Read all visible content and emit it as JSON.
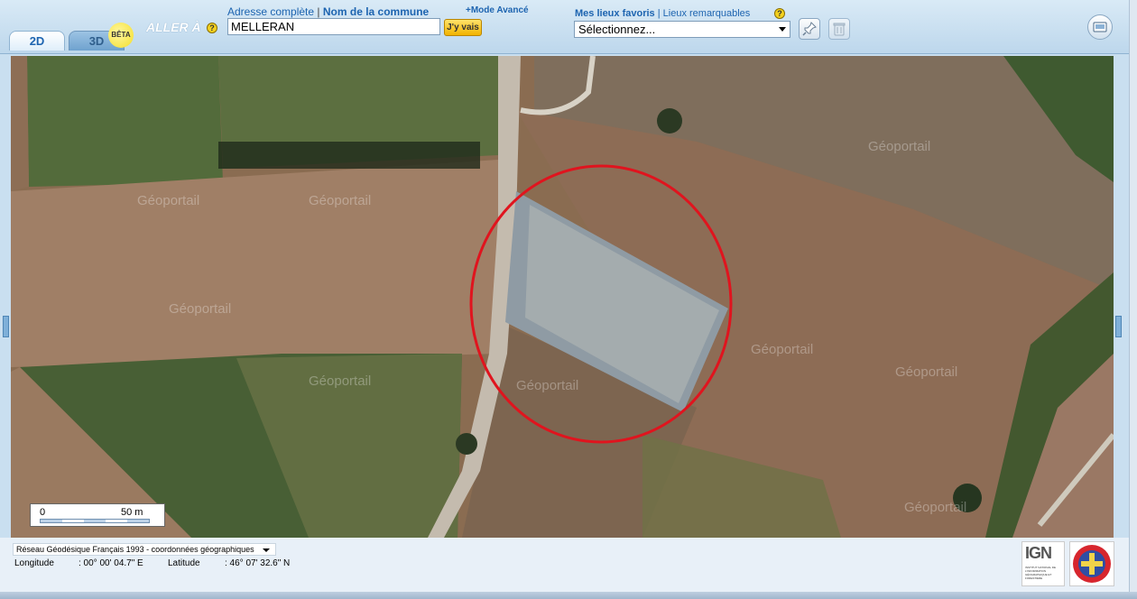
{
  "tabs": {
    "tab_2d": "2D",
    "tab_3d": "3D",
    "beta_badge": "BÊTA"
  },
  "search": {
    "aller_label": "ALLER À",
    "label_full_address": "Adresse complète",
    "label_separator": "|",
    "label_commune": "Nom de la commune",
    "advanced_mode": "+Mode Avancé",
    "value": "MELLERAN",
    "go_button": "J'y vais"
  },
  "help_mark": "?",
  "favorites": {
    "label_favorites": "Mes lieux favoris",
    "label_separator": "|",
    "label_remarkable": "Lieux remarquables",
    "select_value": "Sélectionnez..."
  },
  "map": {
    "watermark": "Géoportail",
    "scale": {
      "start": "0",
      "end": "50 m"
    }
  },
  "footer": {
    "projection": "Réseau Géodésique Français 1993 - coordonnées géographiques",
    "longitude_label": "Longitude",
    "longitude_value": ": 00° 00' 04.7\" E",
    "latitude_label": "Latitude",
    "latitude_value": ": 46° 07' 32.6\" N",
    "ign_logo": "IGN",
    "ign_tagline": "INSTITUT NATIONAL DE L'INFORMATION GÉOGRAPHIQUE ET FORESTIÈRE"
  },
  "icons": {
    "pin": "pin-icon",
    "trash": "trash-icon",
    "print": "print-icon",
    "help": "help-icon"
  },
  "colors": {
    "annotation_circle": "#e0141e",
    "header_bg": "#c9dff0",
    "link_blue": "#1d64b0"
  }
}
